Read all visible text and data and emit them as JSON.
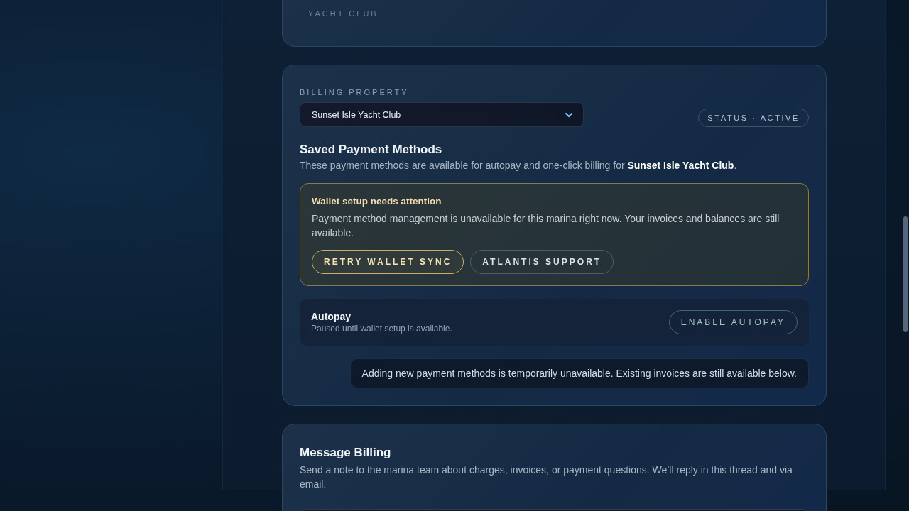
{
  "invoice_row": {
    "property_name_line": "YACHT CLUB"
  },
  "billing": {
    "property_label": "BILLING PROPERTY",
    "property_select": "Sunset Isle Yacht Club",
    "status": "STATUS · ACTIVE",
    "title": "Saved Payment Methods",
    "subtitle": "These payment methods are available for autopay and one-click billing for **Sunset Isle Yacht Club**.",
    "alert": {
      "title": "Wallet setup needs attention",
      "message": "Payment method management is unavailable for this marina right now. Your invoices and balances are still available.",
      "buttons": [
        {
          "label": "RETRY WALLET SYNC",
          "kind": "primary"
        },
        {
          "label": "ATLANTIS SUPPORT",
          "kind": "secondary"
        }
      ]
    },
    "autopay": {
      "title": "Autopay",
      "note": "Paused until wallet setup is available.",
      "button": "ENABLE AUTOPAY",
      "disabled": true
    },
    "notice": "Adding new payment methods is temporarily unavailable. Existing invoices are still available below."
  },
  "message": {
    "title": "Message Billing",
    "description": "Send a note to the marina team about charges, invoices, or payment questions. We’ll reply in this thread and via email."
  }
}
